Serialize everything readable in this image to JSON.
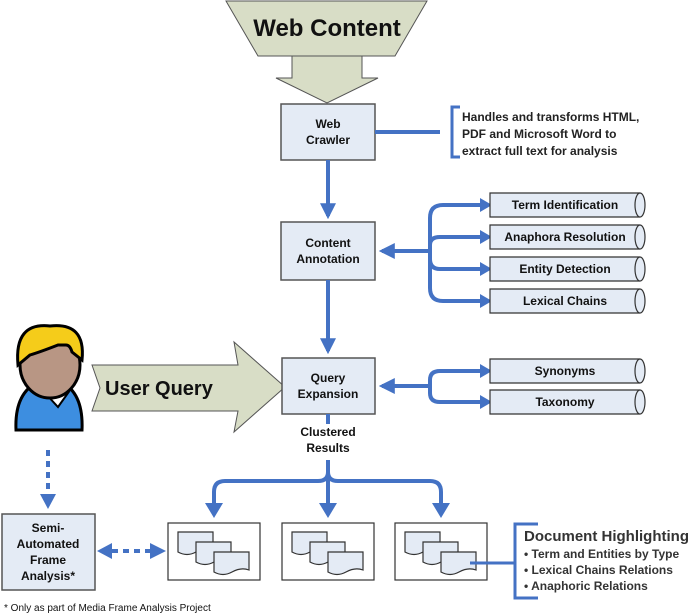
{
  "diagram": {
    "source": "Web Content",
    "crawler": "Web Crawler",
    "crawler_lines": [
      "Web",
      "Crawler"
    ],
    "crawler_note": [
      "Handles and transforms HTML,",
      "PDF and Microsoft Word to",
      "extract full text for analysis"
    ],
    "annotation_lines": [
      "Content",
      "Annotation"
    ],
    "annotation_modules": [
      "Term Identification",
      "Anaphora Resolution",
      "Entity Detection",
      "Lexical Chains"
    ],
    "user_query": "User Query",
    "expansion_lines": [
      "Query",
      "Expansion"
    ],
    "expansion_modules": [
      "Synonyms",
      "Taxonomy"
    ],
    "clustered_lines": [
      "Clustered",
      "Results"
    ],
    "frame_lines": [
      "Semi-",
      "Automated",
      "Frame",
      "Analysis*"
    ],
    "highlighting": {
      "title": "Document Highlighting",
      "items": [
        "Term and Entities by Type",
        "Lexical Chains Relations",
        "Anaphoric Relations"
      ]
    },
    "footnote": "* Only as part of Media Frame Analysis Project",
    "colors": {
      "flow": "#4472c4",
      "box": "#e4ebf5",
      "block_arrow": "#d8ddc6",
      "hair": "#f5cc1a",
      "shirt": "#3d8ee0"
    }
  }
}
